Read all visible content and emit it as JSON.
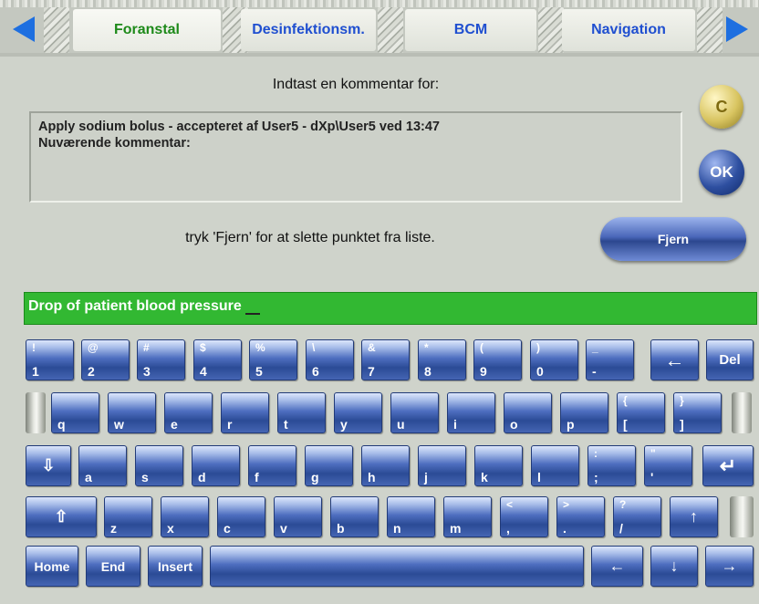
{
  "tabs": [
    {
      "label": "Foranstal",
      "active": true
    },
    {
      "label": "Desinfektionsm.",
      "active": false
    },
    {
      "label": "BCM",
      "active": false
    },
    {
      "label": "Navigation",
      "active": false
    }
  ],
  "nav": {
    "prev_icon": "arrow-left-icon",
    "next_icon": "arrow-right-icon"
  },
  "comment": {
    "prompt": "Indtast en kommentar for:",
    "line1": "Apply sodium bolus - accepteret af User5 - dXp\\User5 ved 13:47",
    "line2": "Nuværende kommentar:"
  },
  "buttons": {
    "clear": "C",
    "ok": "OK",
    "remove": "Fjern"
  },
  "remove_hint": "tryk 'Fjern' for at slette punktet fra liste.",
  "input": {
    "value": "Drop of patient blood pressure"
  },
  "keyboard": {
    "row1": [
      {
        "top": "!",
        "bot": "1"
      },
      {
        "top": "@",
        "bot": "2"
      },
      {
        "top": "#",
        "bot": "3"
      },
      {
        "top": "$",
        "bot": "4"
      },
      {
        "top": "%",
        "bot": "5"
      },
      {
        "top": "\\",
        "bot": "6"
      },
      {
        "top": "&",
        "bot": "7"
      },
      {
        "top": "*",
        "bot": "8"
      },
      {
        "top": "(",
        "bot": "9"
      },
      {
        "top": ")",
        "bot": "0"
      },
      {
        "top": "_",
        "bot": "-"
      }
    ],
    "backspace": "←",
    "del": "Del",
    "row2": [
      {
        "top": "",
        "bot": "q"
      },
      {
        "top": "",
        "bot": "w"
      },
      {
        "top": "",
        "bot": "e"
      },
      {
        "top": "",
        "bot": "r"
      },
      {
        "top": "",
        "bot": "t"
      },
      {
        "top": "",
        "bot": "y"
      },
      {
        "top": "",
        "bot": "u"
      },
      {
        "top": "",
        "bot": "i"
      },
      {
        "top": "",
        "bot": "o"
      },
      {
        "top": "",
        "bot": "p"
      },
      {
        "top": "{",
        "bot": "["
      },
      {
        "top": "}",
        "bot": "]"
      }
    ],
    "caps": "⇩",
    "row3": [
      {
        "top": "",
        "bot": "a"
      },
      {
        "top": "",
        "bot": "s"
      },
      {
        "top": "",
        "bot": "d"
      },
      {
        "top": "",
        "bot": "f"
      },
      {
        "top": "",
        "bot": "g"
      },
      {
        "top": "",
        "bot": "h"
      },
      {
        "top": "",
        "bot": "j"
      },
      {
        "top": "",
        "bot": "k"
      },
      {
        "top": "",
        "bot": "l"
      },
      {
        "top": ":",
        "bot": ";"
      },
      {
        "top": "\"",
        "bot": "'"
      }
    ],
    "enter": "↵",
    "shift": "⇧",
    "row4": [
      {
        "top": "",
        "bot": "z"
      },
      {
        "top": "",
        "bot": "x"
      },
      {
        "top": "",
        "bot": "c"
      },
      {
        "top": "",
        "bot": "v"
      },
      {
        "top": "",
        "bot": "b"
      },
      {
        "top": "",
        "bot": "n"
      },
      {
        "top": "",
        "bot": "m"
      },
      {
        "top": "<",
        "bot": ","
      },
      {
        "top": ">",
        "bot": "."
      },
      {
        "top": "?",
        "bot": "/"
      }
    ],
    "up": "↑",
    "home": "Home",
    "end": "End",
    "insert": "Insert",
    "space": "",
    "left": "←",
    "down": "↓",
    "right": "→"
  }
}
